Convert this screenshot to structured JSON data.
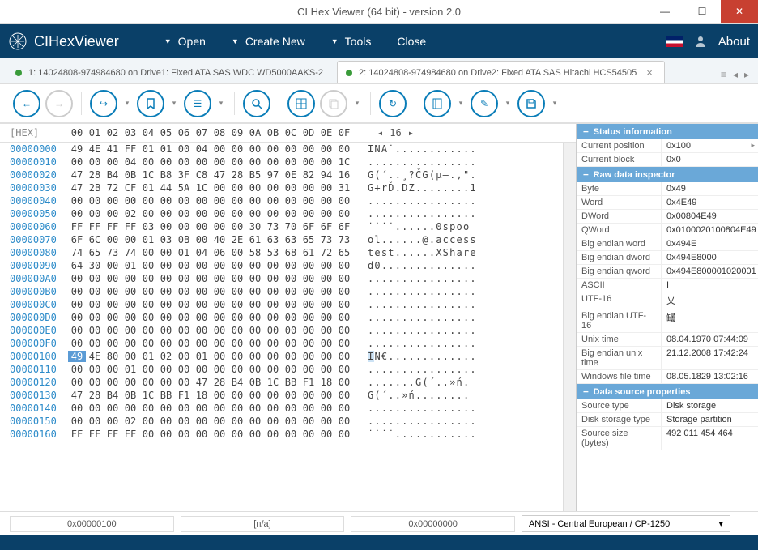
{
  "window": {
    "title": "CI Hex Viewer (64 bit) - version 2.0"
  },
  "app": {
    "name": "CIHexViewer"
  },
  "menu": {
    "open": "Open",
    "create": "Create New",
    "tools": "Tools",
    "close": "Close",
    "about": "About"
  },
  "tabs": {
    "items": [
      {
        "label": "1: 14024808-974984680 on Drive1: Fixed ATA SAS WDC WD5000AAKS-2",
        "active": false
      },
      {
        "label": "2: 14024808-974984680 on Drive2: Fixed ATA SAS Hitachi HCS54505",
        "active": true
      }
    ]
  },
  "hex": {
    "label": "[HEX]",
    "cols": [
      "00",
      "01",
      "02",
      "03",
      "04",
      "05",
      "06",
      "07",
      "08",
      "09",
      "0A",
      "0B",
      "0C",
      "0D",
      "0E",
      "0F"
    ],
    "page": "16",
    "rows": [
      {
        "off": "00000000",
        "b": [
          "49",
          "4E",
          "41",
          "FF",
          "01",
          "01",
          "00",
          "04",
          "00",
          "00",
          "00",
          "00",
          "00",
          "00",
          "00",
          "00"
        ],
        "a": "INA˙............"
      },
      {
        "off": "00000010",
        "b": [
          "00",
          "00",
          "00",
          "04",
          "00",
          "00",
          "00",
          "00",
          "00",
          "00",
          "00",
          "00",
          "00",
          "00",
          "00",
          "1C"
        ],
        "a": "................"
      },
      {
        "off": "00000020",
        "b": [
          "47",
          "28",
          "B4",
          "0B",
          "1C",
          "B8",
          "3F",
          "C8",
          "47",
          "28",
          "B5",
          "97",
          "0E",
          "82",
          "94",
          "16"
        ],
        "a": "G(´..¸?ČG(µ—.‚\"."
      },
      {
        "off": "00000030",
        "b": [
          "47",
          "2B",
          "72",
          "CF",
          "01",
          "44",
          "5A",
          "1C",
          "00",
          "00",
          "00",
          "00",
          "00",
          "00",
          "00",
          "31"
        ],
        "a": "G+rĎ.DZ........1"
      },
      {
        "off": "00000040",
        "b": [
          "00",
          "00",
          "00",
          "00",
          "00",
          "00",
          "00",
          "00",
          "00",
          "00",
          "00",
          "00",
          "00",
          "00",
          "00",
          "00"
        ],
        "a": "................"
      },
      {
        "off": "00000050",
        "b": [
          "00",
          "00",
          "00",
          "02",
          "00",
          "00",
          "00",
          "00",
          "00",
          "00",
          "00",
          "00",
          "00",
          "00",
          "00",
          "00"
        ],
        "a": "................"
      },
      {
        "off": "00000060",
        "b": [
          "FF",
          "FF",
          "FF",
          "FF",
          "03",
          "00",
          "00",
          "00",
          "00",
          "00",
          "30",
          "73",
          "70",
          "6F",
          "6F",
          "6F"
        ],
        "a": "˙˙˙˙......0spoo"
      },
      {
        "off": "00000070",
        "b": [
          "6F",
          "6C",
          "00",
          "00",
          "01",
          "03",
          "0B",
          "00",
          "40",
          "2E",
          "61",
          "63",
          "63",
          "65",
          "73",
          "73"
        ],
        "a": "ol......@.access"
      },
      {
        "off": "00000080",
        "b": [
          "74",
          "65",
          "73",
          "74",
          "00",
          "00",
          "01",
          "04",
          "06",
          "00",
          "58",
          "53",
          "68",
          "61",
          "72",
          "65"
        ],
        "a": "test......XShare"
      },
      {
        "off": "00000090",
        "b": [
          "64",
          "30",
          "00",
          "01",
          "00",
          "00",
          "00",
          "00",
          "00",
          "00",
          "00",
          "00",
          "00",
          "00",
          "00",
          "00"
        ],
        "a": "d0.............."
      },
      {
        "off": "000000A0",
        "b": [
          "00",
          "00",
          "00",
          "00",
          "00",
          "00",
          "00",
          "00",
          "00",
          "00",
          "00",
          "00",
          "00",
          "00",
          "00",
          "00"
        ],
        "a": "................"
      },
      {
        "off": "000000B0",
        "b": [
          "00",
          "00",
          "00",
          "00",
          "00",
          "00",
          "00",
          "00",
          "00",
          "00",
          "00",
          "00",
          "00",
          "00",
          "00",
          "00"
        ],
        "a": "................"
      },
      {
        "off": "000000C0",
        "b": [
          "00",
          "00",
          "00",
          "00",
          "00",
          "00",
          "00",
          "00",
          "00",
          "00",
          "00",
          "00",
          "00",
          "00",
          "00",
          "00"
        ],
        "a": "................"
      },
      {
        "off": "000000D0",
        "b": [
          "00",
          "00",
          "00",
          "00",
          "00",
          "00",
          "00",
          "00",
          "00",
          "00",
          "00",
          "00",
          "00",
          "00",
          "00",
          "00"
        ],
        "a": "................"
      },
      {
        "off": "000000E0",
        "b": [
          "00",
          "00",
          "00",
          "00",
          "00",
          "00",
          "00",
          "00",
          "00",
          "00",
          "00",
          "00",
          "00",
          "00",
          "00",
          "00"
        ],
        "a": "................"
      },
      {
        "off": "000000F0",
        "b": [
          "00",
          "00",
          "00",
          "00",
          "00",
          "00",
          "00",
          "00",
          "00",
          "00",
          "00",
          "00",
          "00",
          "00",
          "00",
          "00"
        ],
        "a": "................"
      },
      {
        "off": "00000100",
        "b": [
          "49",
          "4E",
          "80",
          "00",
          "01",
          "02",
          "00",
          "01",
          "00",
          "00",
          "00",
          "00",
          "00",
          "00",
          "00",
          "00"
        ],
        "a": "IN€.............",
        "hl": 0,
        "ahl": 0
      },
      {
        "off": "00000110",
        "b": [
          "00",
          "00",
          "00",
          "01",
          "00",
          "00",
          "00",
          "00",
          "00",
          "00",
          "00",
          "00",
          "00",
          "00",
          "00",
          "00"
        ],
        "a": "................"
      },
      {
        "off": "00000120",
        "b": [
          "00",
          "00",
          "00",
          "00",
          "00",
          "00",
          "00",
          "47",
          "28",
          "B4",
          "0B",
          "1C",
          "BB",
          "F1",
          "18",
          "00"
        ],
        "a": ".......G(´..»ń."
      },
      {
        "off": "00000130",
        "b": [
          "47",
          "28",
          "B4",
          "0B",
          "1C",
          "BB",
          "F1",
          "18",
          "00",
          "00",
          "00",
          "00",
          "00",
          "00",
          "00",
          "00"
        ],
        "a": "G(´..»ń........"
      },
      {
        "off": "00000140",
        "b": [
          "00",
          "00",
          "00",
          "00",
          "00",
          "00",
          "00",
          "00",
          "00",
          "00",
          "00",
          "00",
          "00",
          "00",
          "00",
          "00"
        ],
        "a": "................"
      },
      {
        "off": "00000150",
        "b": [
          "00",
          "00",
          "00",
          "02",
          "00",
          "00",
          "00",
          "00",
          "00",
          "00",
          "00",
          "00",
          "00",
          "00",
          "00",
          "00"
        ],
        "a": "................"
      },
      {
        "off": "00000160",
        "b": [
          "FF",
          "FF",
          "FF",
          "FF",
          "00",
          "00",
          "00",
          "00",
          "00",
          "00",
          "00",
          "00",
          "00",
          "00",
          "00",
          "00"
        ],
        "a": "˙˙˙˙............"
      }
    ]
  },
  "inspector": {
    "sections": {
      "status": "Status information",
      "raw": "Raw data inspector",
      "source": "Data source properties"
    },
    "status": [
      {
        "k": "Current position",
        "v": "0x100",
        "arrow": true
      },
      {
        "k": "Current block",
        "v": "0x0"
      }
    ],
    "raw": [
      {
        "k": "Byte",
        "v": "0x49"
      },
      {
        "k": "Word",
        "v": "0x4E49"
      },
      {
        "k": "DWord",
        "v": "0x00804E49"
      },
      {
        "k": "QWord",
        "v": "0x0100020100804E49"
      },
      {
        "k": "Big endian word",
        "v": "0x494E"
      },
      {
        "k": "Big endian dword",
        "v": "0x494E8000"
      },
      {
        "k": "Big endian qword",
        "v": "0x494E800001020001"
      },
      {
        "k": "ASCII",
        "v": "I"
      },
      {
        "k": "UTF-16",
        "v": "乂"
      },
      {
        "k": "Big endian UTF-16",
        "v": "罎"
      },
      {
        "k": "Unix time",
        "v": "08.04.1970 07:44:09"
      },
      {
        "k": "Big endian unix time",
        "v": "21.12.2008 17:42:24"
      },
      {
        "k": "Windows file time",
        "v": "08.05.1829 13:02:16"
      }
    ],
    "source": [
      {
        "k": "Source type",
        "v": "Disk storage"
      },
      {
        "k": "Disk storage type",
        "v": "Storage partition"
      },
      {
        "k": "Source size (bytes)",
        "v": "492 011 454 464"
      }
    ]
  },
  "status": {
    "pos": "0x00000100",
    "sel": "[n/a]",
    "off": "0x00000000",
    "enc": "ANSI - Central European / CP-1250"
  }
}
